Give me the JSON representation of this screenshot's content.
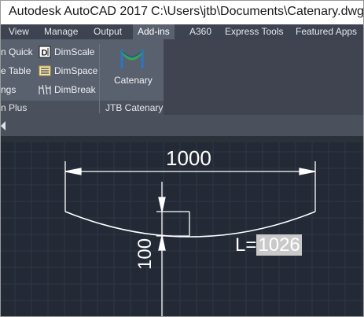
{
  "window": {
    "app_title": "Autodesk AutoCAD 2017",
    "file_path": "C:\\Users\\jtb\\Documents\\Catenary.dwg"
  },
  "ribbon_tabs": [
    {
      "label": "View"
    },
    {
      "label": "Manage"
    },
    {
      "label": "Output"
    },
    {
      "label": "Add-ins",
      "active": true
    },
    {
      "label": "A360"
    },
    {
      "label": "Express Tools"
    },
    {
      "label": "Featured Apps"
    }
  ],
  "ribbon": {
    "left_panel": {
      "title": "n Plus",
      "items_col1": [
        "n Quick",
        "e Table",
        "ngs"
      ],
      "items_col2": [
        {
          "label": "DimScale",
          "icon": "dimscale-icon"
        },
        {
          "label": "DimSpace",
          "icon": "dimspace-icon"
        },
        {
          "label": "DimBreak",
          "icon": "dimbreak-icon"
        }
      ]
    },
    "jtb_panel": {
      "title": "JTB Catenary",
      "button_label": "Catenary",
      "icon": "catenary-icon"
    }
  },
  "drawing": {
    "span_dimension": "1000",
    "sag_dimension": "100",
    "length_prefix": "L=",
    "length_value": "1026"
  },
  "colors": {
    "title_bg": "#ffffff",
    "tab_bar_bg": "#3d4350",
    "ribbon_bg": "#59606e",
    "canvas_bg": "#232a36",
    "grid_line": "#2f3745",
    "drawing_line": "#ffffff",
    "catenary_icon_blue": "#2d74c9",
    "catenary_icon_green": "#36a84a"
  }
}
